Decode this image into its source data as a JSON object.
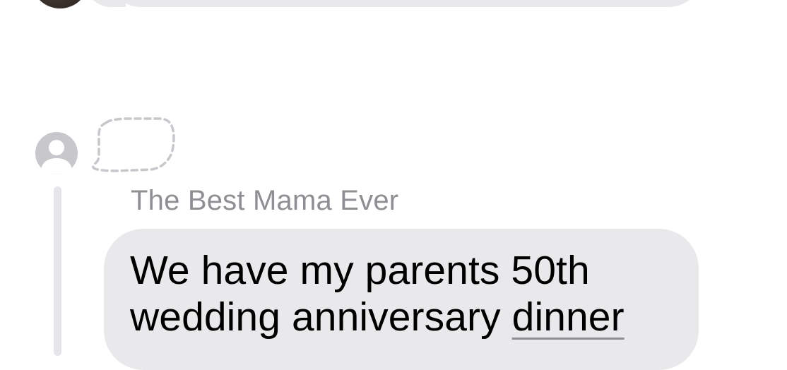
{
  "thread": {
    "previous_message": {
      "sender_avatar_icon": "photo-avatar-icon"
    },
    "reply": {
      "sender_name": "The Best Mama Ever",
      "avatar_icon": "person-placeholder-icon",
      "tapback_icon": "dashed-thought-bubble-icon",
      "message_line_1": "We have my parents 50th",
      "message_line_2_prefix": "wedding anniversary ",
      "message_line_2_link": "dinner"
    }
  },
  "colors": {
    "bubble": "#e9e9eb",
    "sender_name": "#8e8e93",
    "avatar_placeholder": "#c7c7cc",
    "thread_line": "#e5e5ea"
  }
}
